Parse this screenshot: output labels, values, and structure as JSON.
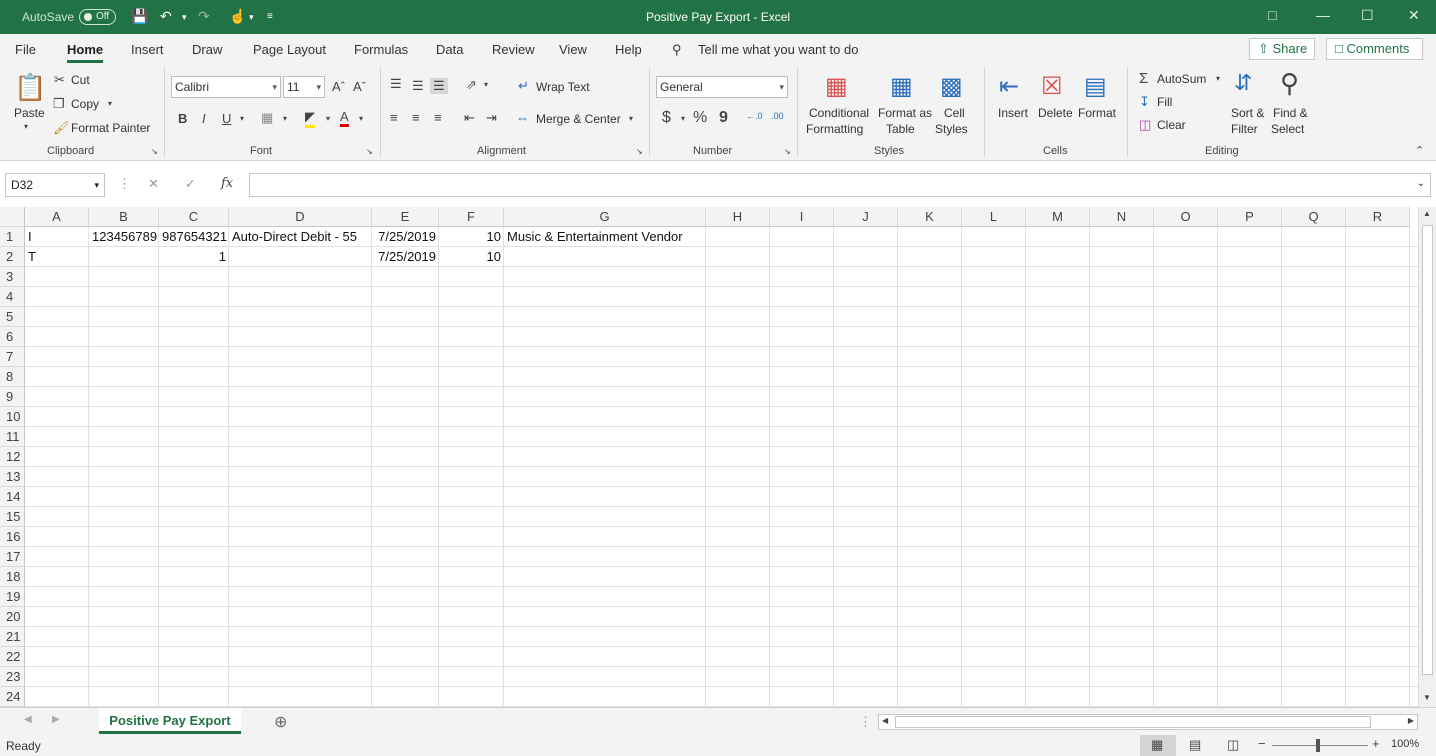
{
  "title_bar": {
    "autosave_label": "AutoSave",
    "autosave_state": "Off",
    "document_title": "Positive Pay Export  -  Excel",
    "save_icon": "save-icon",
    "undo_icon": "undo-icon",
    "redo_icon": "redo-icon",
    "touch_icon": "touch-mode-icon"
  },
  "tabs": [
    "File",
    "Home",
    "Insert",
    "Draw",
    "Page Layout",
    "Formulas",
    "Data",
    "Review",
    "View",
    "Help"
  ],
  "tell_me": "Tell me what you want to do",
  "share_label": "Share",
  "comments_label": "Comments",
  "ribbon": {
    "clipboard": {
      "paste": "Paste",
      "cut": "Cut",
      "copy": "Copy",
      "format_painter": "Format Painter",
      "group": "Clipboard"
    },
    "font": {
      "name": "Calibri",
      "size": "11",
      "bold": "B",
      "italic": "I",
      "underline": "U",
      "group": "Font"
    },
    "alignment": {
      "wrap": "Wrap Text",
      "merge": "Merge & Center",
      "group": "Alignment"
    },
    "number": {
      "format": "General",
      "currency": "$",
      "percent": "%",
      "comma": "9",
      "group": "Number"
    },
    "styles": {
      "conditional_1": "Conditional",
      "conditional_2": "Formatting",
      "table_1": "Format as",
      "table_2": "Table",
      "cell_1": "Cell",
      "cell_2": "Styles",
      "group": "Styles"
    },
    "cells": {
      "insert": "Insert",
      "delete": "Delete",
      "format": "Format",
      "group": "Cells"
    },
    "editing": {
      "autosum": "AutoSum",
      "fill": "Fill",
      "clear": "Clear",
      "sort_1": "Sort &",
      "sort_2": "Filter",
      "find_1": "Find &",
      "find_2": "Select",
      "group": "Editing"
    }
  },
  "formula_bar": {
    "name_box": "D32",
    "fx": "fx",
    "formula": ""
  },
  "columns": [
    "A",
    "B",
    "C",
    "D",
    "E",
    "F",
    "G",
    "H",
    "I",
    "J",
    "K",
    "L",
    "M",
    "N",
    "O",
    "P",
    "Q",
    "R"
  ],
  "rows": [
    "1",
    "2",
    "3",
    "4",
    "5",
    "6",
    "7",
    "8",
    "9",
    "10",
    "11",
    "12",
    "13",
    "14",
    "15",
    "16",
    "17",
    "18",
    "19",
    "20",
    "21",
    "22",
    "23",
    "24"
  ],
  "cells": {
    "A1": "I",
    "B1": "123456789",
    "C1": "987654321",
    "D1": "Auto-Direct Debit - 55",
    "E1": "7/25/2019",
    "F1": "10",
    "G1": "Music & Entertainment Vendor",
    "A2": "T",
    "C2": "1",
    "E2": "7/25/2019",
    "F2": "10"
  },
  "sheet_tab": "Positive Pay Export",
  "status": {
    "ready": "Ready",
    "zoom": "100%"
  }
}
